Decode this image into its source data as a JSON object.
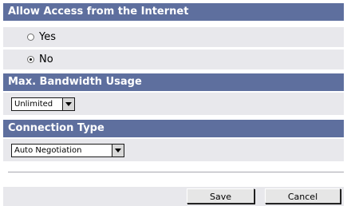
{
  "access": {
    "title": "Allow Access from the Internet",
    "options": [
      {
        "label": "Yes",
        "selected": false
      },
      {
        "label": "No",
        "selected": true
      }
    ]
  },
  "bandwidth": {
    "title": "Max. Bandwidth Usage",
    "value": "Unlimited"
  },
  "connection": {
    "title": "Connection Type",
    "value": "Auto Negotiation"
  },
  "actions": {
    "save_label": "Save",
    "cancel_label": "Cancel"
  },
  "colors": {
    "header_bg": "#5e6f9e",
    "row_bg": "#e8e8ec"
  }
}
